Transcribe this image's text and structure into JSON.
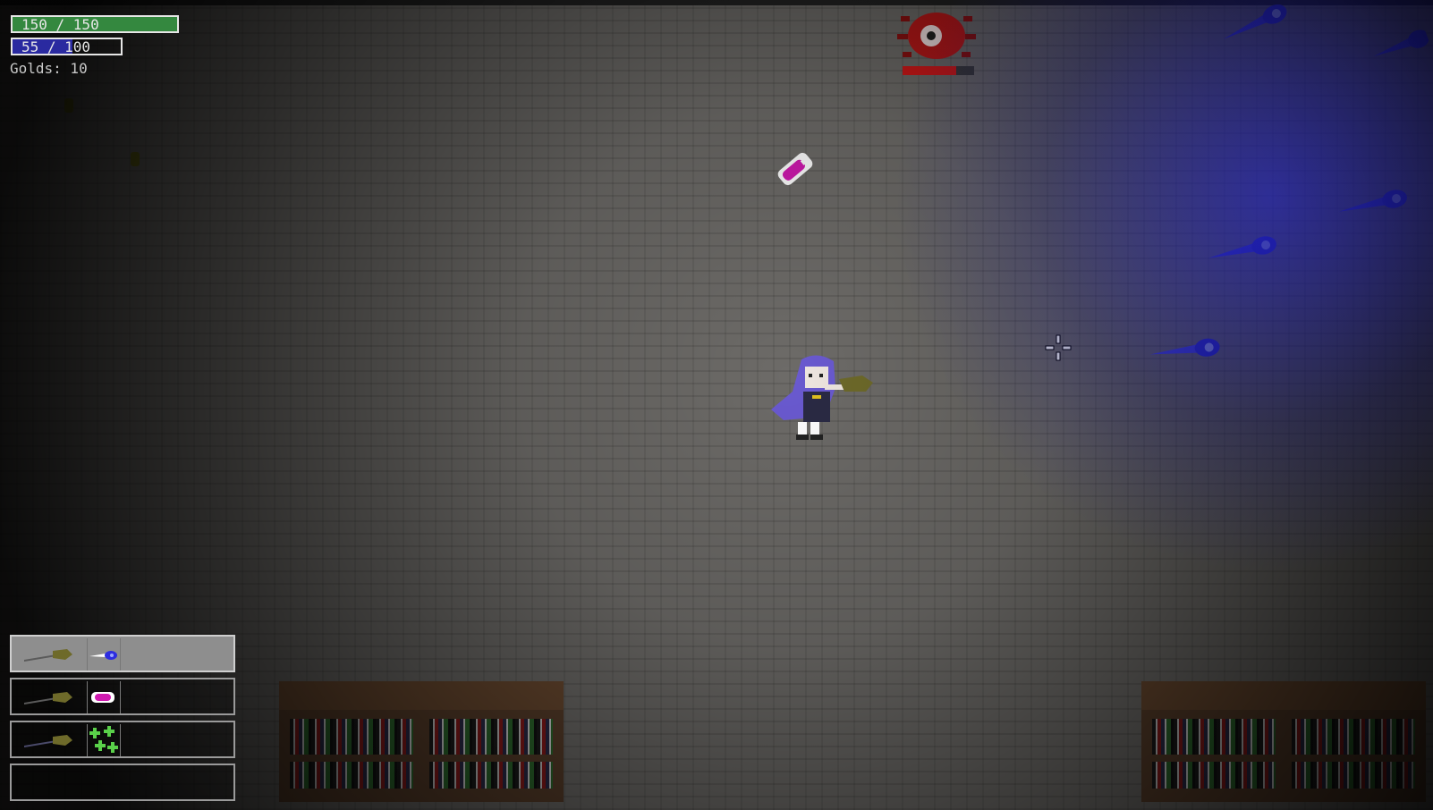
{
  "hud": {
    "health_text": "150 / 150",
    "health_fraction": 1.0,
    "mana_text": "55 / 100",
    "mana_fraction": 0.55,
    "gold_text": "Golds: 10"
  },
  "colors": {
    "health": "#34883f",
    "mana": "#2a2aa0",
    "enemy_health": "#d01818",
    "blue_projectile": "#3434f0",
    "pink_pickup": "#d01ab0"
  },
  "hotbar": {
    "slots": [
      {
        "wand": "wand-icon",
        "spell": "blue-bolt-icon",
        "selected": true
      },
      {
        "wand": "wand-icon",
        "spell": "pink-bolt-icon",
        "selected": false
      },
      {
        "wand": "wand-icon",
        "spell": "green-sparkle-icon",
        "selected": false
      },
      {
        "wand": "",
        "spell": "",
        "selected": false
      }
    ]
  },
  "enemy": {
    "name_icon": "red-eye-spider-icon",
    "health_fraction": 0.75
  },
  "player": {
    "icon": "purple-hooded-wizard-icon"
  },
  "cursor": {
    "icon": "crosshair-icon"
  }
}
